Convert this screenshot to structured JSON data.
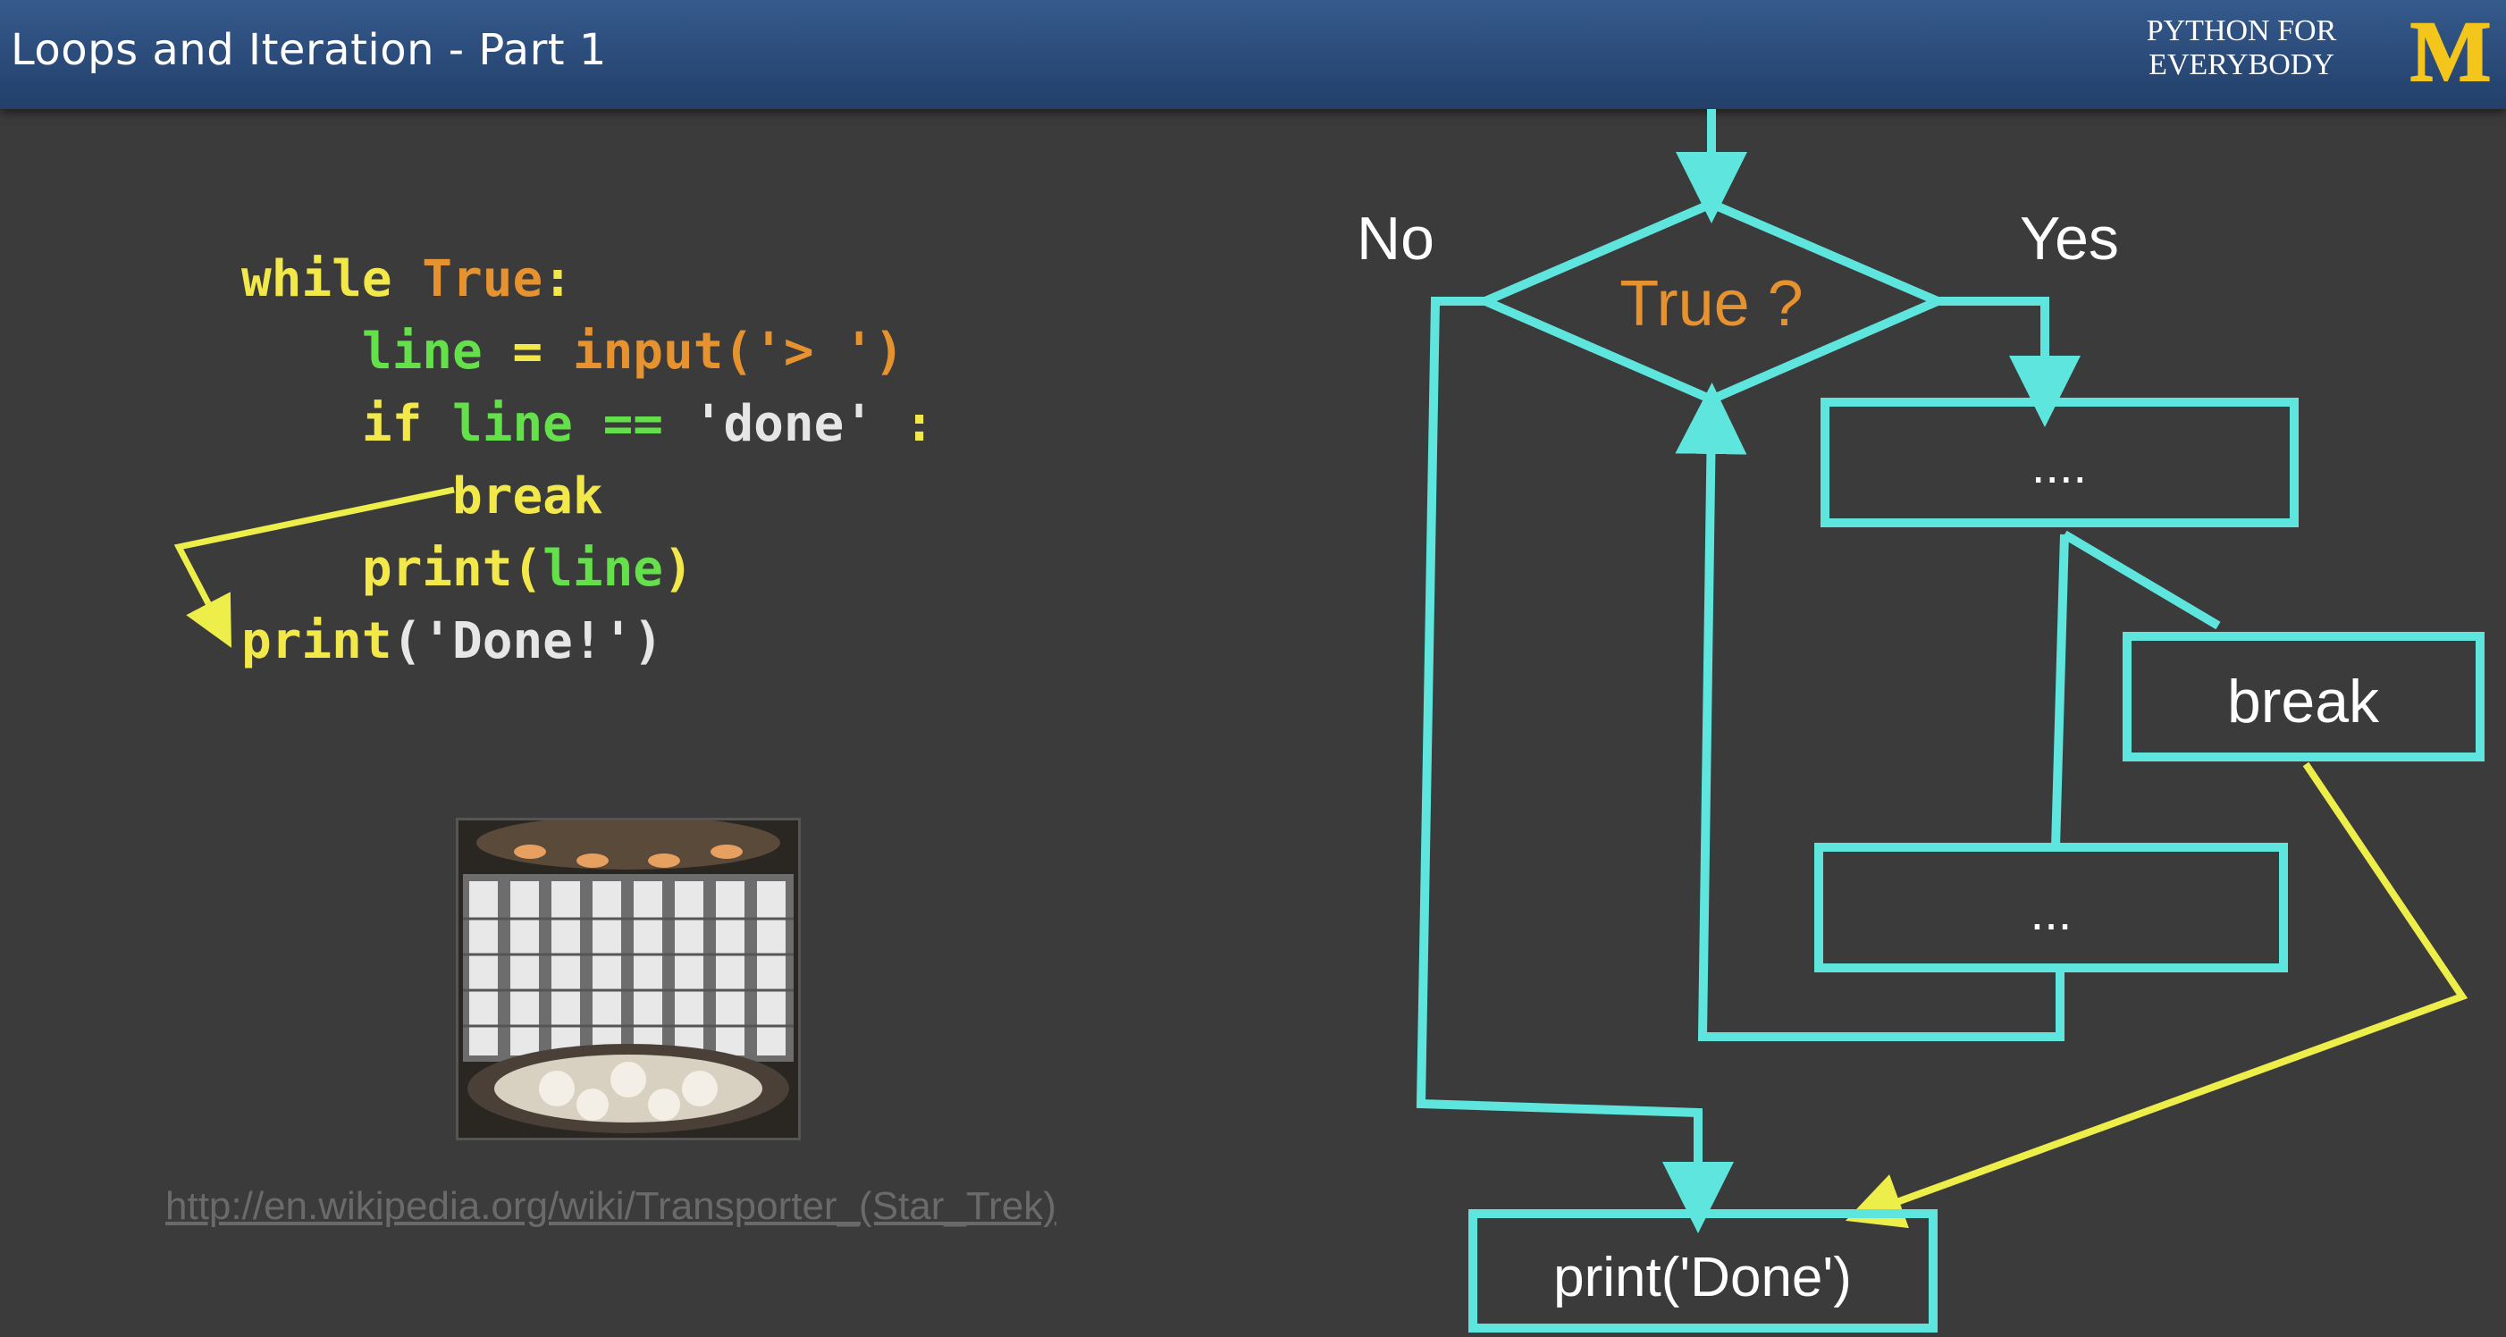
{
  "header": {
    "title": "Loops and Iteration - Part 1",
    "brand_line1": "PYTHON FOR",
    "brand_line2": "EVERYBODY",
    "logo_letter": "M"
  },
  "code": {
    "line1_kw": "while",
    "line1_true": "True",
    "line1_colon": ":",
    "line2_var": "line",
    "line2_eq": " = ",
    "line2_fn": "input",
    "line2_args": "('> ')",
    "line3_kw": "if",
    "line3_var": "line",
    "line3_op": " == ",
    "line3_str": "'done'",
    "line3_colon": " :",
    "line4_kw": "break",
    "line5_kw": "print",
    "line5_open": "(",
    "line5_var": "line",
    "line5_close": ")",
    "line6_kw": "print",
    "line6_args": "('Done!')"
  },
  "image_credit_link": "http://en.wikipedia.org/wiki/Transporter_(Star_Trek)",
  "flowchart": {
    "no_label": "No",
    "yes_label": "Yes",
    "decision": "True ?",
    "box_top": "....",
    "box_break": "break",
    "box_bottom": "...",
    "box_done": "print('Done')"
  },
  "colors": {
    "flow_cyan": "#5ee6de",
    "flow_yellow": "#eeee4a",
    "decision_text": "#e6922f",
    "header_blue": "#2a4a78",
    "logo_yellow": "#f4c51b"
  }
}
